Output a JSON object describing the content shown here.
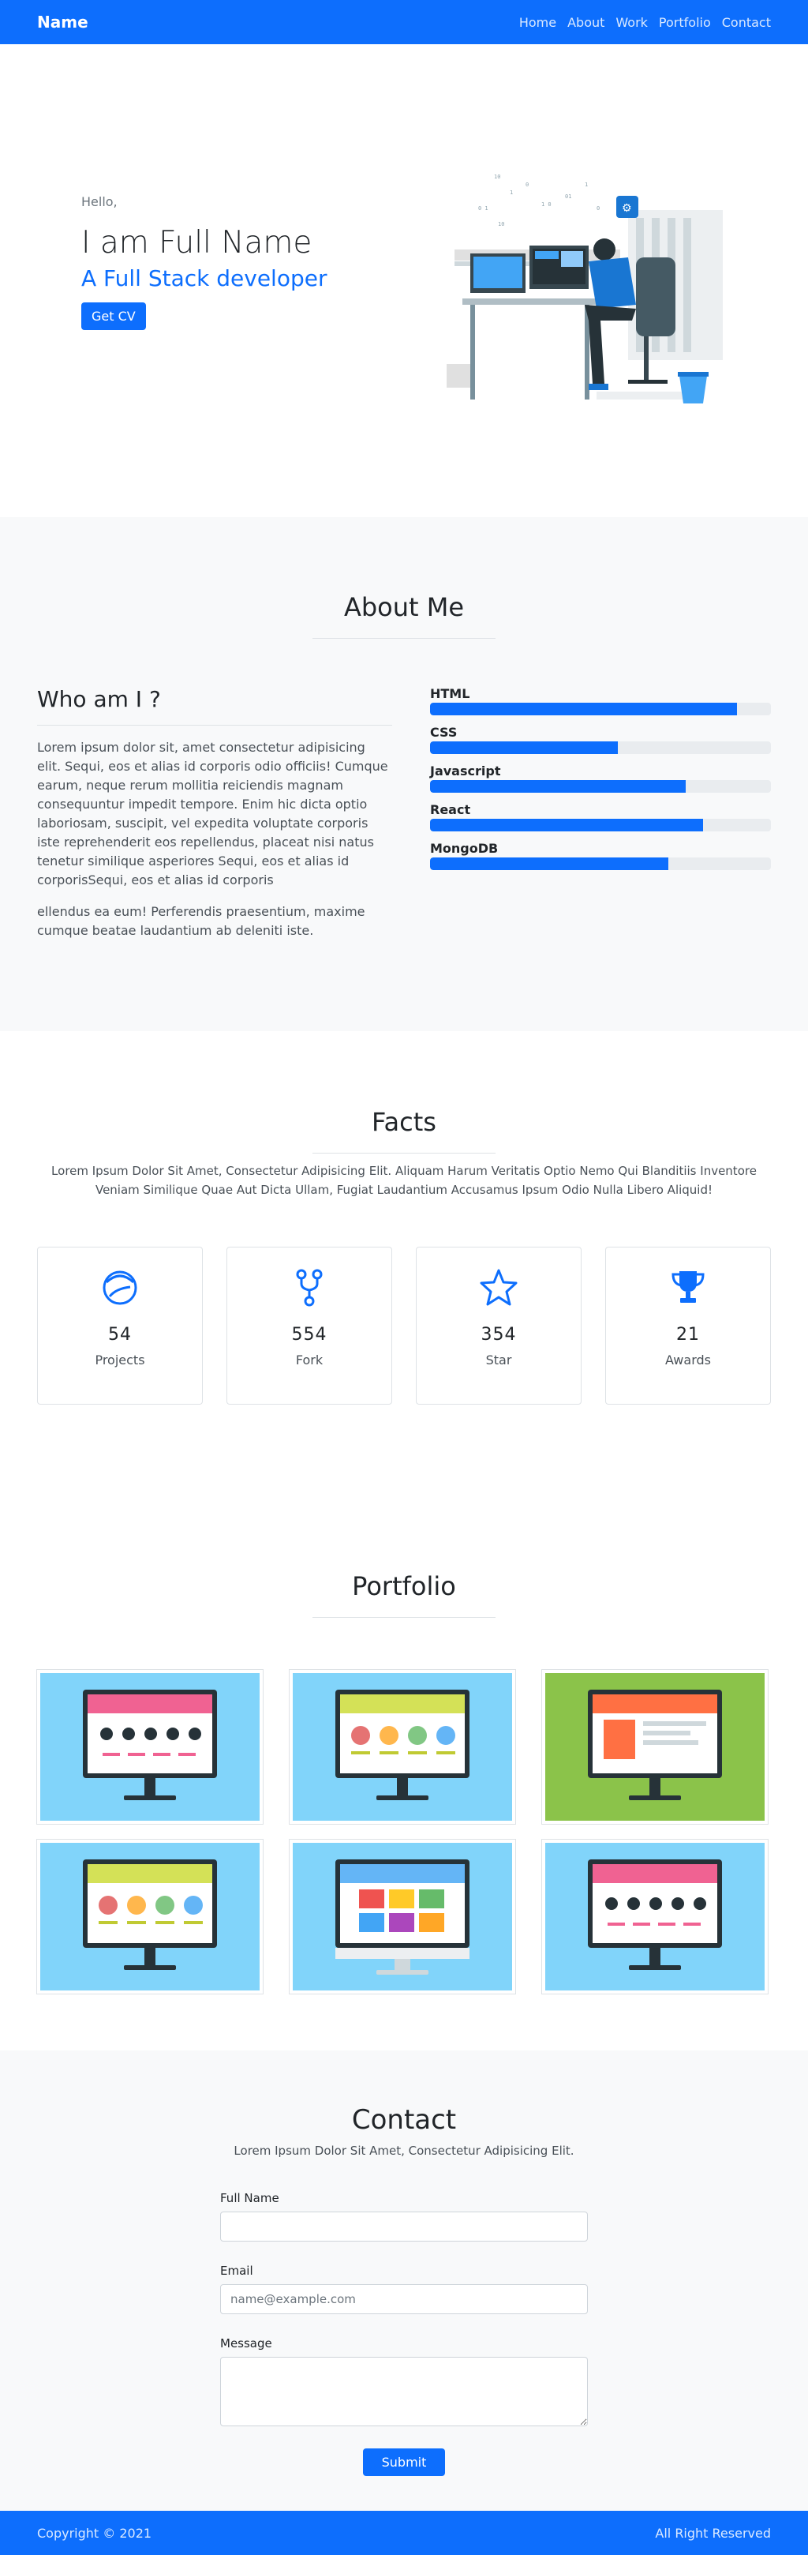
{
  "navbar": {
    "brand": "Name",
    "links": [
      "Home",
      "About",
      "Work",
      "Portfolio",
      "Contact"
    ]
  },
  "hero": {
    "greeting": "Hello,",
    "name": "I am Full Name",
    "role": "A Full Stack developer",
    "cv_button": "Get CV"
  },
  "about": {
    "title": "About Me",
    "subtitle": "Who am I ?",
    "paragraphs": [
      "Lorem ipsum dolor sit, amet consectetur adipisicing elit. Sequi, eos et alias id corporis odio officiis! Cumque earum, neque rerum mollitia reiciendis magnam consequuntur impedit tempore. Enim hic dicta optio laboriosam, suscipit, vel expedita voluptate corporis iste reprehenderit eos repellendus, placeat nisi natus tenetur similique asperiores Sequi, eos et alias id corporisSequi, eos et alias id corporis",
      "ellendus ea eum! Perferendis praesentium, maxime cumque beatae laudantium ab deleniti iste."
    ],
    "skills": [
      {
        "name": "HTML",
        "level": 0.9
      },
      {
        "name": "CSS",
        "level": 0.55
      },
      {
        "name": "Javascript",
        "level": 0.75
      },
      {
        "name": "React",
        "level": 0.8
      },
      {
        "name": "MongoDB",
        "level": 0.7
      }
    ]
  },
  "facts": {
    "title": "Facts",
    "subtitle": "Lorem Ipsum Dolor Sit Amet, Consectetur Adipisicing Elit. Aliquam Harum Veritatis Optio Nemo Qui Blanditiis Inventore Veniam Similique Quae Aut Dicta Ullam, Fugiat Laudantium Accusamus Ipsum Odio Nulla Libero Aliquid!",
    "items": [
      {
        "number": "54",
        "label": "Projects",
        "icon": "globe-icon"
      },
      {
        "number": "554",
        "label": "Fork",
        "icon": "fork-icon"
      },
      {
        "number": "354",
        "label": "Star",
        "icon": "star-icon"
      },
      {
        "number": "21",
        "label": "Awards",
        "icon": "trophy-icon"
      }
    ],
    "accent": "#0d6efd"
  },
  "portfolio": {
    "title": "Portfolio",
    "tiles": [
      {
        "bg": "#81d4fa",
        "banner": "#f06292",
        "kind": "shop"
      },
      {
        "bg": "#81d4fa",
        "banner": "#d4e157",
        "kind": "icons"
      },
      {
        "bg": "#8bc34a",
        "banner": "#ff7043",
        "kind": "product"
      },
      {
        "bg": "#81d4fa",
        "banner": "#d4e157",
        "kind": "icons"
      },
      {
        "bg": "#81d4fa",
        "banner": "#64b5f6",
        "kind": "imac"
      },
      {
        "bg": "#81d4fa",
        "banner": "#f06292",
        "kind": "shop"
      }
    ]
  },
  "contact": {
    "title": "Contact",
    "subtitle": "Lorem Ipsum Dolor Sit Amet, Consectetur Adipisicing Elit.",
    "name_label": "Full Name",
    "name_value": "",
    "email_label": "Email",
    "email_placeholder": "name@example.com",
    "message_label": "Message",
    "submit": "Submit"
  },
  "footer": {
    "copyright": "Copyright © 2021",
    "rights": "All Right Reserved"
  },
  "colors": {
    "primary": "#0d6efd",
    "grey_bg": "#f8f9fa"
  }
}
